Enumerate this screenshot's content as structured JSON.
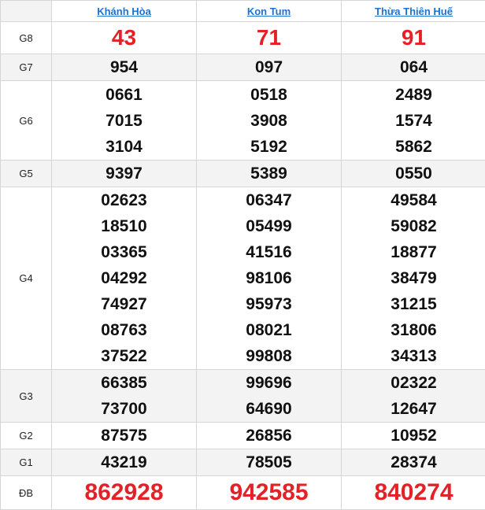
{
  "header": {
    "corner": "",
    "provinces": [
      "Khánh Hòa",
      "Kon Tum",
      "Thừa Thiên Huế"
    ]
  },
  "rows": [
    {
      "label": "G8",
      "values": [
        [
          "43"
        ],
        [
          "71"
        ],
        [
          "91"
        ]
      ]
    },
    {
      "label": "G7",
      "values": [
        [
          "954"
        ],
        [
          "097"
        ],
        [
          "064"
        ]
      ]
    },
    {
      "label": "G6",
      "values": [
        [
          "0661",
          "7015",
          "3104"
        ],
        [
          "0518",
          "3908",
          "5192"
        ],
        [
          "2489",
          "1574",
          "5862"
        ]
      ]
    },
    {
      "label": "G5",
      "values": [
        [
          "9397"
        ],
        [
          "5389"
        ],
        [
          "0550"
        ]
      ]
    },
    {
      "label": "G4",
      "values": [
        [
          "02623",
          "18510",
          "03365",
          "04292",
          "74927",
          "08763",
          "37522"
        ],
        [
          "06347",
          "05499",
          "41516",
          "98106",
          "95973",
          "08021",
          "99808"
        ],
        [
          "49584",
          "59082",
          "18877",
          "38479",
          "31215",
          "31806",
          "34313"
        ]
      ]
    },
    {
      "label": "G3",
      "values": [
        [
          "66385",
          "73700"
        ],
        [
          "99696",
          "64690"
        ],
        [
          "02322",
          "12647"
        ]
      ]
    },
    {
      "label": "G2",
      "values": [
        [
          "87575"
        ],
        [
          "26856"
        ],
        [
          "10952"
        ]
      ]
    },
    {
      "label": "G1",
      "values": [
        [
          "43219"
        ],
        [
          "78505"
        ],
        [
          "28374"
        ]
      ]
    },
    {
      "label": "ĐB",
      "values": [
        [
          "862928"
        ],
        [
          "942585"
        ],
        [
          "840274"
        ]
      ]
    }
  ],
  "colors": {
    "accent_red": "#e32127",
    "link_blue": "#1b73d3",
    "row_shade": "#f3f3f3",
    "border": "#d6d6d6"
  }
}
